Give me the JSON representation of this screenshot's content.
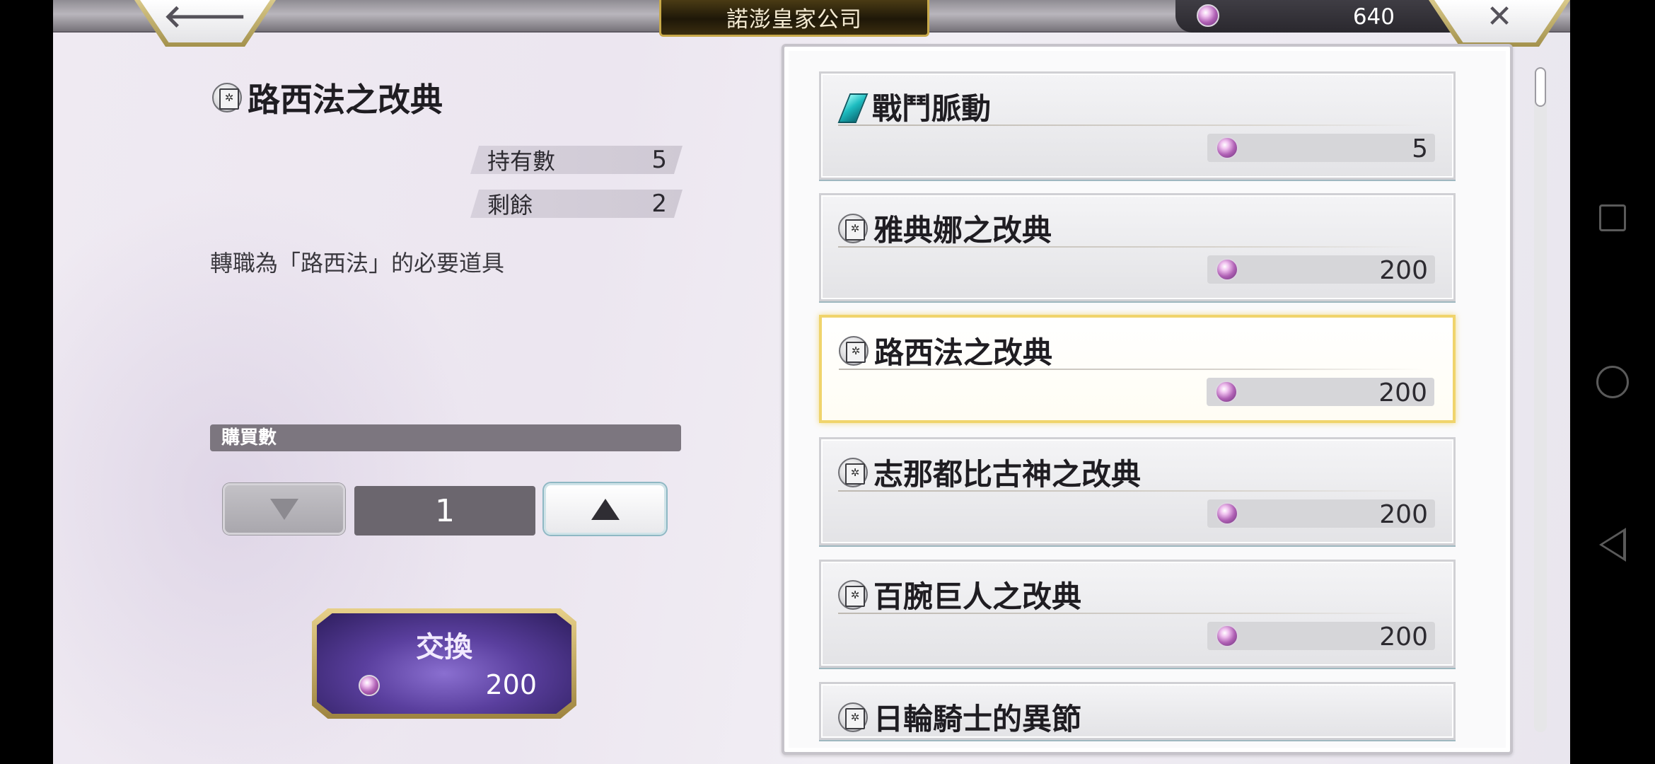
{
  "header": {
    "title": "諾澎皇家公司",
    "back_glyph": "🡐",
    "close_glyph": "✕",
    "currency_amount": "640"
  },
  "detail": {
    "item_name": "路西法之改典",
    "owned_label": "持有數",
    "owned_value": "5",
    "remaining_label": "剩餘",
    "remaining_value": "2",
    "description": "轉職為「路西法」的必要道具",
    "quantity_label": "購買數",
    "quantity_value": "1",
    "exchange_label": "交換",
    "exchange_price": "200"
  },
  "items": [
    {
      "name": "戰鬥脈動",
      "price": "5",
      "icon": "crystal-icon"
    },
    {
      "name": "雅典娜之改典",
      "price": "200",
      "icon": "book-icon"
    },
    {
      "name": "路西法之改典",
      "price": "200",
      "icon": "book-icon",
      "selected": true
    },
    {
      "name": "志那都比古神之改典",
      "price": "200",
      "icon": "book-icon"
    },
    {
      "name": "百腕巨人之改典",
      "price": "200",
      "icon": "book-icon"
    },
    {
      "name": "日輪騎士的異節",
      "price": "",
      "icon": "book-icon"
    }
  ],
  "colors": {
    "selected_border": "#f0d46c",
    "gem": "#b061b5",
    "title_plate_gold": "#c8a94a"
  }
}
